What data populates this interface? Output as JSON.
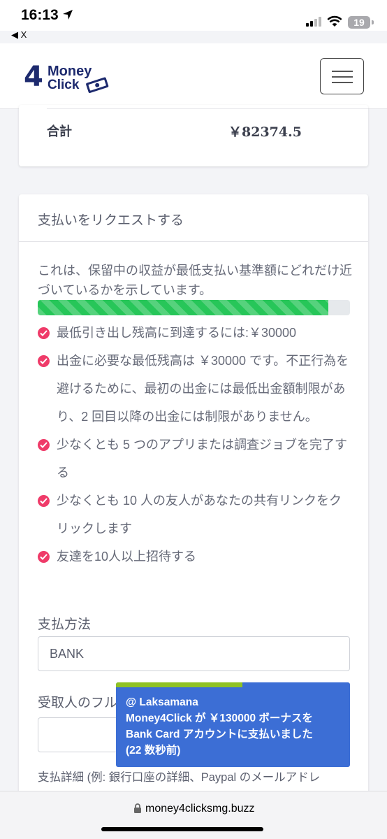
{
  "status_bar": {
    "time": "16:13",
    "battery": "19",
    "back_app": "X"
  },
  "header": {
    "logo_number": "4",
    "logo_word1": "Money",
    "logo_word2": "Click"
  },
  "summary": {
    "label": "合計",
    "value": "￥82374.5"
  },
  "payout": {
    "title": "支払いをリクエストする",
    "description": "これは、保留中の収益が最低支払い基準額にどれだけ近づいているかを示しています。",
    "progress_percent": 93,
    "requirements": [
      "最低引き出し残高に到達するには:￥30000",
      "出金に必要な最低残高は ￥30000 です。不正行為を避けるために、最初の出金には最低出金額制限があり、2 回目以降の出金には制限がありません。",
      "少なくとも 5 つのアプリまたは調査ジョブを完了する",
      "少なくとも 10 人の友人があなたの共有リンクをクリックします",
      "友達を10人以上招待する"
    ],
    "method_label": "支払方法",
    "method_value": "BANK",
    "recipient_label": "受取人のフル",
    "recipient_value": "",
    "details_label": "支払詳細 (例: 銀行口座の詳細、Paypal のメールアドレ"
  },
  "toast": {
    "line1": "@ Laksamana",
    "line2": "Money4Click が ￥130000 ボーナスを",
    "line3": "Bank Card アカウントに支払いました",
    "line4": "(22 数秒前)",
    "timer_fraction": 0.54
  },
  "browser": {
    "url": "money4clicksmg.buzz"
  }
}
